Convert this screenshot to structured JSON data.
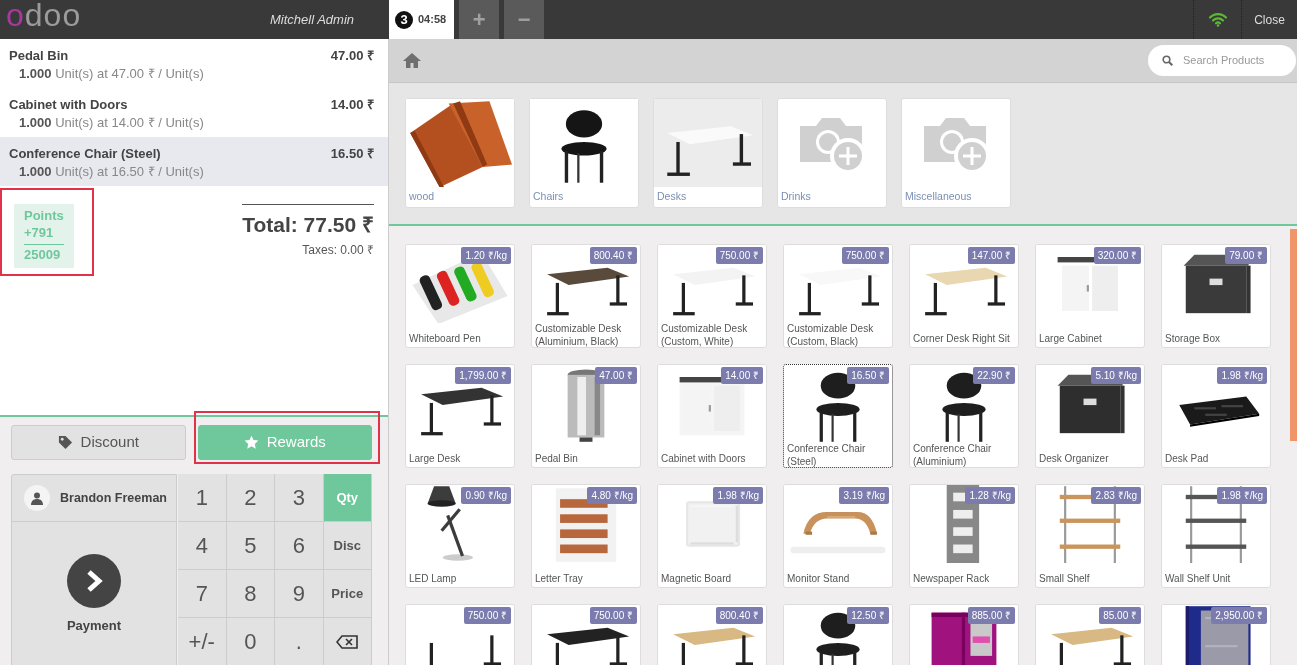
{
  "header": {
    "logo": "odoo",
    "user": "Mitchell Admin",
    "order_tabs": [
      {
        "number": "3",
        "time": "04:58",
        "selected": true
      }
    ],
    "new_order": "+",
    "delete_order": "−",
    "connected": true,
    "close": "Close"
  },
  "order": {
    "lines": [
      {
        "name": "Pedal Bin",
        "price": "47.00 ₹",
        "qty": "1.000",
        "info": "Unit(s) at 47.00 ₹ / Unit(s)",
        "selected": false
      },
      {
        "name": "Cabinet with Doors",
        "price": "14.00 ₹",
        "qty": "1.000",
        "info": "Unit(s) at 14.00 ₹ / Unit(s)",
        "selected": false
      },
      {
        "name": "Conference Chair (Steel)",
        "price": "16.50 ₹",
        "qty": "1.000",
        "info": "Unit(s) at 16.50 ₹ / Unit(s)",
        "selected": true
      }
    ],
    "loyalty": {
      "label": "Points",
      "won": "+791",
      "total": "25009",
      "highlighted": true
    },
    "total": "Total: 77.50 ₹",
    "taxes": "Taxes: 0.00 ₹"
  },
  "actions": [
    {
      "kind": "discount",
      "label": "Discount",
      "primary": false,
      "highlighted": false
    },
    {
      "kind": "rewards",
      "label": "Rewards",
      "primary": true,
      "highlighted": true
    }
  ],
  "customer": "Brandon Freeman",
  "payment": "Payment",
  "numpad": [
    [
      {
        "kind": "digit",
        "label": "1"
      },
      {
        "kind": "digit",
        "label": "2"
      },
      {
        "kind": "digit",
        "label": "3"
      },
      {
        "kind": "mode",
        "label": "Qty",
        "selected": true
      }
    ],
    [
      {
        "kind": "digit",
        "label": "4"
      },
      {
        "kind": "digit",
        "label": "5"
      },
      {
        "kind": "digit",
        "label": "6"
      },
      {
        "kind": "mode",
        "label": "Disc",
        "selected": false
      }
    ],
    [
      {
        "kind": "digit",
        "label": "7"
      },
      {
        "kind": "digit",
        "label": "8"
      },
      {
        "kind": "digit",
        "label": "9"
      },
      {
        "kind": "mode",
        "label": "Price",
        "selected": false
      }
    ],
    [
      {
        "kind": "digit",
        "label": "+/-"
      },
      {
        "kind": "digit",
        "label": "0"
      },
      {
        "kind": "digit",
        "label": "."
      },
      {
        "kind": "backspace"
      }
    ]
  ],
  "search": {
    "placeholder": "Search Products"
  },
  "categories": [
    {
      "name": "wood",
      "kind": "picture"
    },
    {
      "name": "Chairs",
      "kind": "picture"
    },
    {
      "name": "Desks",
      "kind": "picture"
    },
    {
      "name": "Drinks",
      "kind": "placeholder"
    },
    {
      "name": "Miscellaneous",
      "kind": "placeholder"
    }
  ],
  "products": [
    {
      "name": "Whiteboard Pen",
      "price": "1.20 ₹/kg",
      "selected": false
    },
    {
      "name": "Customizable Desk (Aluminium, Black)",
      "price": "800.40 ₹",
      "selected": false
    },
    {
      "name": "Customizable Desk (Custom, White)",
      "price": "750.00 ₹",
      "selected": false
    },
    {
      "name": "Customizable Desk (Custom, Black)",
      "price": "750.00 ₹",
      "selected": false
    },
    {
      "name": "Corner Desk Right Sit",
      "price": "147.00 ₹",
      "selected": false
    },
    {
      "name": "Large Cabinet",
      "price": "320.00 ₹",
      "selected": false
    },
    {
      "name": "Storage Box",
      "price": "79.00 ₹",
      "selected": false
    },
    {
      "name": "Large Desk",
      "price": "1,799.00 ₹",
      "selected": false
    },
    {
      "name": "Pedal Bin",
      "price": "47.00 ₹",
      "selected": false
    },
    {
      "name": "Cabinet with Doors",
      "price": "14.00 ₹",
      "selected": false
    },
    {
      "name": "Conference Chair (Steel)",
      "price": "16.50 ₹",
      "selected": true
    },
    {
      "name": "Conference Chair (Aluminium)",
      "price": "22.90 ₹",
      "selected": false
    },
    {
      "name": "Desk Organizer",
      "price": "5.10 ₹/kg",
      "selected": false
    },
    {
      "name": "Desk Pad",
      "price": "1.98 ₹/kg",
      "selected": false
    },
    {
      "name": "LED Lamp",
      "price": "0.90 ₹/kg",
      "selected": false
    },
    {
      "name": "Letter Tray",
      "price": "4.80 ₹/kg",
      "selected": false
    },
    {
      "name": "Magnetic Board",
      "price": "1.98 ₹/kg",
      "selected": false
    },
    {
      "name": "Monitor Stand",
      "price": "3.19 ₹/kg",
      "selected": false
    },
    {
      "name": "Newspaper Rack",
      "price": "1.28 ₹/kg",
      "selected": false
    },
    {
      "name": "Small Shelf",
      "price": "2.83 ₹/kg",
      "selected": false
    },
    {
      "name": "Wall Shelf Unit",
      "price": "1.98 ₹/kg",
      "selected": false
    },
    {
      "price": "750.00 ₹",
      "selected": false
    },
    {
      "price": "750.00 ₹",
      "selected": false
    },
    {
      "price": "800.40 ₹",
      "selected": false
    },
    {
      "price": "12.50 ₹",
      "selected": false
    },
    {
      "price": "885.00 ₹",
      "selected": false
    },
    {
      "price": "85.00 ₹",
      "selected": false
    },
    {
      "price": "2,950.00 ₹",
      "selected": false
    }
  ]
}
